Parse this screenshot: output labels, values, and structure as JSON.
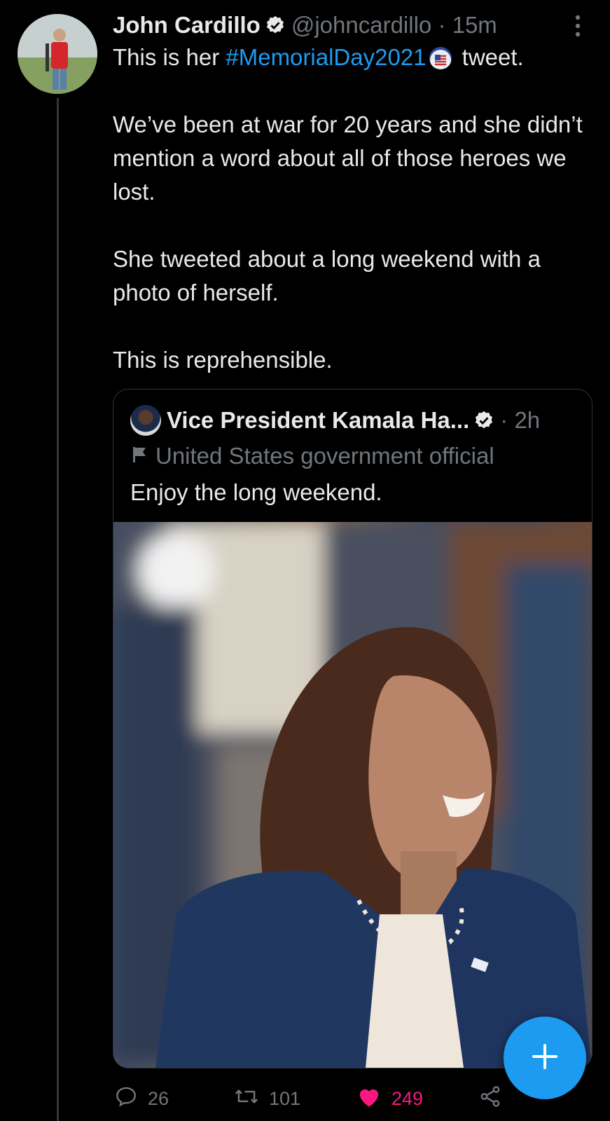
{
  "tweet": {
    "author_name": "John Cardillo",
    "handle_time": "@johncardillo · 15m",
    "line1_before": "This is her ",
    "hashtag": "#MemorialDay2021",
    "line1_after": " tweet.",
    "paragraph2": "We’ve been at war for 20 years and she didn’t mention a word about all of those heroes we lost.",
    "paragraph3": "She tweeted about a long weekend with a photo of herself.",
    "paragraph4": "This is reprehensible."
  },
  "quote": {
    "author_name": "Vice President Kamala Ha...",
    "time": "· 2h",
    "label": "United States government official",
    "text": "Enjoy the long weekend."
  },
  "actions": {
    "replies": "26",
    "retweets": "101",
    "likes": "249"
  },
  "colors": {
    "background": "#000000",
    "accent": "#1d9bf0",
    "like": "#f91880",
    "secondary_text": "#71767b"
  },
  "icons": [
    "verified-icon",
    "more-icon",
    "flag-icon",
    "reply-icon",
    "retweet-icon",
    "heart-icon",
    "share-icon",
    "plus-icon"
  ]
}
